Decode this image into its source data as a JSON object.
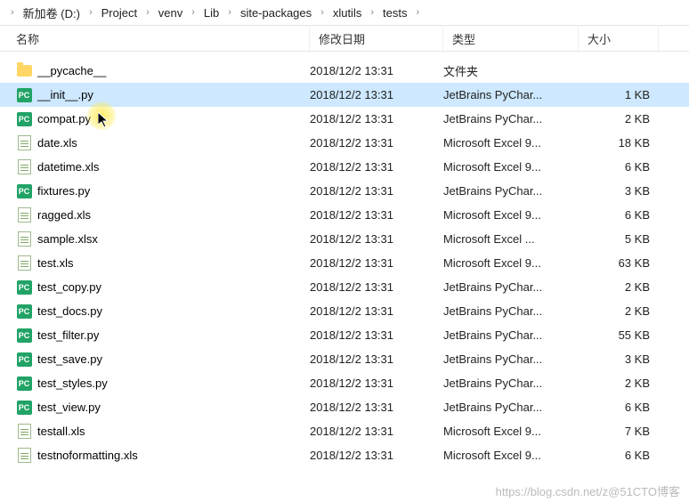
{
  "breadcrumbs": [
    "新加卷 (D:)",
    "Project",
    "venv",
    "Lib",
    "site-packages",
    "xlutils",
    "tests"
  ],
  "columns": {
    "name": "名称",
    "date": "修改日期",
    "type": "类型",
    "size": "大小"
  },
  "files": [
    {
      "name": "__pycache__",
      "date": "2018/12/2 13:31",
      "type": "文件夹",
      "size": "",
      "icon": "folder",
      "selected": false
    },
    {
      "name": "__init__.py",
      "date": "2018/12/2 13:31",
      "type": "JetBrains PyChar...",
      "size": "1 KB",
      "icon": "py",
      "selected": true
    },
    {
      "name": "compat.py",
      "date": "2018/12/2 13:31",
      "type": "JetBrains PyChar...",
      "size": "2 KB",
      "icon": "py",
      "selected": false
    },
    {
      "name": "date.xls",
      "date": "2018/12/2 13:31",
      "type": "Microsoft Excel 9...",
      "size": "18 KB",
      "icon": "xls",
      "selected": false
    },
    {
      "name": "datetime.xls",
      "date": "2018/12/2 13:31",
      "type": "Microsoft Excel 9...",
      "size": "6 KB",
      "icon": "xls",
      "selected": false
    },
    {
      "name": "fixtures.py",
      "date": "2018/12/2 13:31",
      "type": "JetBrains PyChar...",
      "size": "3 KB",
      "icon": "py",
      "selected": false
    },
    {
      "name": "ragged.xls",
      "date": "2018/12/2 13:31",
      "type": "Microsoft Excel 9...",
      "size": "6 KB",
      "icon": "xls",
      "selected": false
    },
    {
      "name": "sample.xlsx",
      "date": "2018/12/2 13:31",
      "type": "Microsoft Excel ...",
      "size": "5 KB",
      "icon": "xls",
      "selected": false
    },
    {
      "name": "test.xls",
      "date": "2018/12/2 13:31",
      "type": "Microsoft Excel 9...",
      "size": "63 KB",
      "icon": "xls",
      "selected": false
    },
    {
      "name": "test_copy.py",
      "date": "2018/12/2 13:31",
      "type": "JetBrains PyChar...",
      "size": "2 KB",
      "icon": "py",
      "selected": false
    },
    {
      "name": "test_docs.py",
      "date": "2018/12/2 13:31",
      "type": "JetBrains PyChar...",
      "size": "2 KB",
      "icon": "py",
      "selected": false
    },
    {
      "name": "test_filter.py",
      "date": "2018/12/2 13:31",
      "type": "JetBrains PyChar...",
      "size": "55 KB",
      "icon": "py",
      "selected": false
    },
    {
      "name": "test_save.py",
      "date": "2018/12/2 13:31",
      "type": "JetBrains PyChar...",
      "size": "3 KB",
      "icon": "py",
      "selected": false
    },
    {
      "name": "test_styles.py",
      "date": "2018/12/2 13:31",
      "type": "JetBrains PyChar...",
      "size": "2 KB",
      "icon": "py",
      "selected": false
    },
    {
      "name": "test_view.py",
      "date": "2018/12/2 13:31",
      "type": "JetBrains PyChar...",
      "size": "6 KB",
      "icon": "py",
      "selected": false
    },
    {
      "name": "testall.xls",
      "date": "2018/12/2 13:31",
      "type": "Microsoft Excel 9...",
      "size": "7 KB",
      "icon": "xls",
      "selected": false
    },
    {
      "name": "testnoformatting.xls",
      "date": "2018/12/2 13:31",
      "type": "Microsoft Excel 9...",
      "size": "6 KB",
      "icon": "xls",
      "selected": false
    }
  ],
  "watermark": "https://blog.csdn.net/z@51CTO博客"
}
